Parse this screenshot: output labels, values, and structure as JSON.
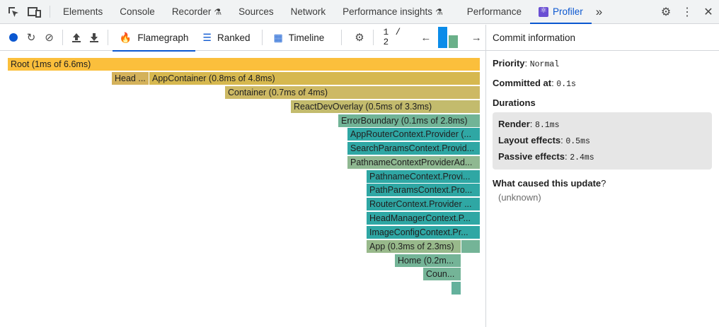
{
  "devtools_tabs": [
    {
      "label": "Elements",
      "active": false
    },
    {
      "label": "Console",
      "active": false
    },
    {
      "label": "Recorder",
      "active": false,
      "flask": true
    },
    {
      "label": "Sources",
      "active": false
    },
    {
      "label": "Network",
      "active": false
    },
    {
      "label": "Performance insights",
      "active": false,
      "flask": true
    },
    {
      "label": "Performance",
      "active": false
    },
    {
      "label": "Profiler",
      "active": true
    }
  ],
  "more_tabs_glyph": "»",
  "profiler_tabs": {
    "flamegraph": "Flamegraph",
    "ranked": "Ranked",
    "timeline": "Timeline"
  },
  "commit_nav": {
    "current": "1",
    "separator": "/",
    "total": "2"
  },
  "commits": [
    {
      "index": 1,
      "selected": true
    },
    {
      "index": 2,
      "selected": false
    }
  ],
  "flamegraph": [
    {
      "label": "Root (1ms of 6.6ms)",
      "color": "#fbbf3c"
    },
    {
      "label": "Head ...",
      "color": "#d4b25b"
    },
    {
      "label": "AppContainer (0.8ms of 4.8ms)",
      "color": "#d6b84f"
    },
    {
      "label": "Container (0.7ms of 4ms)",
      "color": "#cdb964"
    },
    {
      "label": "ReactDevOverlay (0.5ms of 3.3ms)",
      "color": "#c3bb6d"
    },
    {
      "label": "ErrorBoundary (0.1ms of 2.8ms)",
      "color": "#71b497"
    },
    {
      "label": "AppRouterContext.Provider (...",
      "color": "#2fa7a4"
    },
    {
      "label": "SearchParamsContext.Provid...",
      "color": "#2fa7a4"
    },
    {
      "label": "PathnameContextProviderAd...",
      "color": "#8fb891"
    },
    {
      "label": "PathnameContext.Provi...",
      "color": "#2fa7a4"
    },
    {
      "label": "PathParamsContext.Pro...",
      "color": "#2fa7a4"
    },
    {
      "label": "RouterContext.Provider ...",
      "color": "#2fa7a4"
    },
    {
      "label": "HeadManagerContext.P...",
      "color": "#2fa7a4"
    },
    {
      "label": "ImageConfigContext.Pr...",
      "color": "#2fa7a4"
    },
    {
      "label": "App (0.3ms of 2.3ms)",
      "color": "#98b98b"
    },
    {
      "label": "",
      "color": "#74b497"
    },
    {
      "label": "Home (0.2m...",
      "color": "#74b497"
    },
    {
      "label": "Coun...",
      "color": "#74b497"
    },
    {
      "label": "",
      "color": "#64b19c"
    }
  ],
  "commit_info": {
    "header": "Commit information",
    "priority_label": "Priority",
    "priority_value": "Normal",
    "committed_label": "Committed at",
    "committed_value": "0.1s",
    "durations_label": "Durations",
    "render_label": "Render",
    "render_value": "8.1ms",
    "layout_label": "Layout effects",
    "layout_value": "0.5ms",
    "passive_label": "Passive effects",
    "passive_value": "2.4ms",
    "cause_label": "What caused this update",
    "cause_q": "?",
    "cause_value": "(unknown)"
  }
}
